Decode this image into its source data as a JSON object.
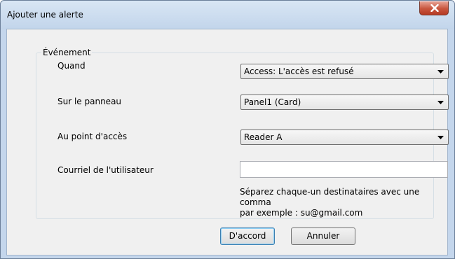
{
  "window": {
    "title": "Ajouter une alerte"
  },
  "group": {
    "legend": "Événement"
  },
  "fields": {
    "when_label": "Quand",
    "when_value": "Access:  L'accès est refusé",
    "panel_label": "Sur le panneau",
    "panel_value": "Panel1 (Card)",
    "access_point_label": "Au point d'accès",
    "access_point_value": "Reader A",
    "email_label": "Courriel  de l'utilisateur",
    "email_value": ""
  },
  "hint": {
    "line1": "Séparez chaque-un destinataires avec une comma",
    "line2": "par exemple : su@gmail.com"
  },
  "buttons": {
    "ok": "D'accord",
    "cancel": "Annuler"
  },
  "colors": {
    "title_bar": "#c4d6ec",
    "close_button": "#c8553d",
    "client_bg": "#f0f0f0"
  },
  "icons": {
    "close": "close-icon",
    "dropdown": "chevron-down-icon"
  }
}
